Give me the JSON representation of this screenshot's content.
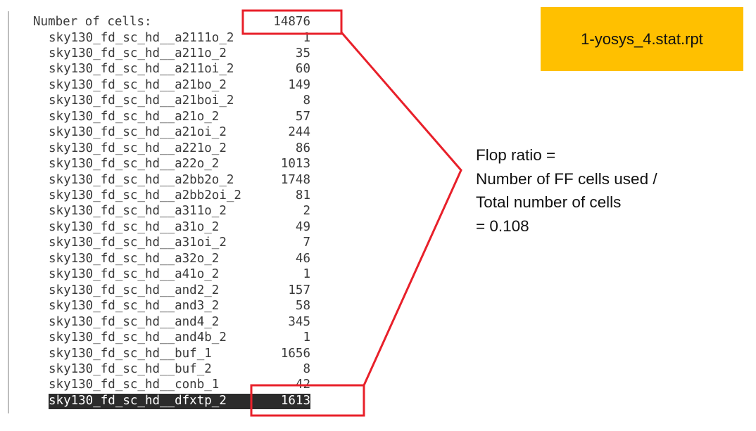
{
  "report": {
    "header_label": "Number of cells:",
    "header_total": "14876",
    "cells": [
      {
        "name": "sky130_fd_sc_hd__a2111o_2",
        "count": "1"
      },
      {
        "name": "sky130_fd_sc_hd__a211o_2",
        "count": "35"
      },
      {
        "name": "sky130_fd_sc_hd__a211oi_2",
        "count": "60"
      },
      {
        "name": "sky130_fd_sc_hd__a21bo_2",
        "count": "149"
      },
      {
        "name": "sky130_fd_sc_hd__a21boi_2",
        "count": "8"
      },
      {
        "name": "sky130_fd_sc_hd__a21o_2",
        "count": "57"
      },
      {
        "name": "sky130_fd_sc_hd__a21oi_2",
        "count": "244"
      },
      {
        "name": "sky130_fd_sc_hd__a221o_2",
        "count": "86"
      },
      {
        "name": "sky130_fd_sc_hd__a22o_2",
        "count": "1013"
      },
      {
        "name": "sky130_fd_sc_hd__a2bb2o_2",
        "count": "1748"
      },
      {
        "name": "sky130_fd_sc_hd__a2bb2oi_2",
        "count": "81"
      },
      {
        "name": "sky130_fd_sc_hd__a311o_2",
        "count": "2"
      },
      {
        "name": "sky130_fd_sc_hd__a31o_2",
        "count": "49"
      },
      {
        "name": "sky130_fd_sc_hd__a31oi_2",
        "count": "7"
      },
      {
        "name": "sky130_fd_sc_hd__a32o_2",
        "count": "46"
      },
      {
        "name": "sky130_fd_sc_hd__a41o_2",
        "count": "1"
      },
      {
        "name": "sky130_fd_sc_hd__and2_2",
        "count": "157"
      },
      {
        "name": "sky130_fd_sc_hd__and3_2",
        "count": "58"
      },
      {
        "name": "sky130_fd_sc_hd__and4_2",
        "count": "345"
      },
      {
        "name": "sky130_fd_sc_hd__and4b_2",
        "count": "1"
      },
      {
        "name": "sky130_fd_sc_hd__buf_1",
        "count": "1656"
      },
      {
        "name": "sky130_fd_sc_hd__buf_2",
        "count": "8"
      },
      {
        "name": "sky130_fd_sc_hd__conb_1",
        "count": "42"
      },
      {
        "name": "sky130_fd_sc_hd__dfxtp_2",
        "count": "1613",
        "highlighted": true
      }
    ]
  },
  "title_box": {
    "label": "1-yosys_4.stat.rpt"
  },
  "note": {
    "lines": [
      "Flop ratio =",
      "Number of FF cells used /",
      "Total number of cells",
      "= 0.108"
    ]
  },
  "colors": {
    "title_box_bg": "#FFC000",
    "annotation_red": "#E8202A",
    "highlight_bar": "#2B2B2B"
  }
}
